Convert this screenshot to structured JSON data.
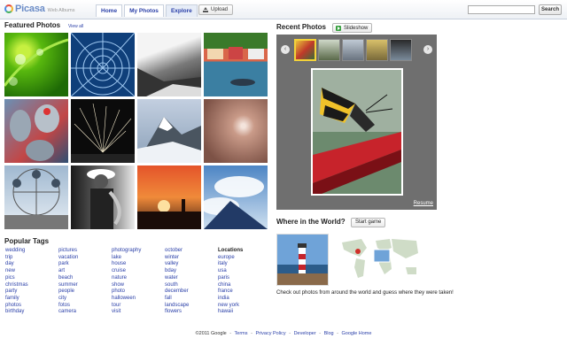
{
  "header": {
    "logo_text": "Picasa",
    "logo_sub": "Web Albums",
    "tabs": [
      {
        "label": "Home"
      },
      {
        "label": "My Photos"
      },
      {
        "label": "Explore"
      }
    ],
    "upload_label": "Upload",
    "search_value": "",
    "search_button": "Search"
  },
  "featured": {
    "title": "Featured Photos",
    "view_all": "View all",
    "photos": [
      "leaf-droplets",
      "glass-dome",
      "river-bw",
      "harbor-village",
      "spray-cans",
      "fireworks",
      "snowy-peak",
      "hazy-sun",
      "ferris-wheel",
      "saxophone-player",
      "sunset-silhouette",
      "blue-sky-clouds"
    ]
  },
  "tags": {
    "title": "Popular Tags",
    "columns": [
      [
        "wedding",
        "trip",
        "day",
        "new",
        "pics",
        "christmas",
        "party",
        "family",
        "photos",
        "birthday"
      ],
      [
        "pictures",
        "vacation",
        "park",
        "art",
        "beach",
        "summer",
        "people",
        "city",
        "fotos",
        "camera"
      ],
      [
        "photography",
        "lake",
        "house",
        "cruise",
        "nature",
        "show",
        "photo",
        "halloween",
        "tour",
        "visit"
      ],
      [
        "october",
        "winter",
        "valley",
        "bday",
        "water",
        "south",
        "december",
        "fall",
        "landscape",
        "flowers"
      ]
    ],
    "locations_title": "Locations",
    "locations": [
      "europe",
      "italy",
      "usa",
      "paris",
      "china",
      "france",
      "india",
      "new york",
      "hawaii"
    ]
  },
  "recent": {
    "title": "Recent Photos",
    "slideshow_label": "Slideshow",
    "resume_label": "Resume",
    "prev_icon": "chevron-left-icon",
    "next_icon": "chevron-right-icon"
  },
  "world": {
    "title": "Where in the World?",
    "start_game_label": "Start game",
    "description": "Check out photos from around the world and guess where they were taken!"
  },
  "footer": {
    "copyright": "©2011 Google",
    "links": [
      "Terms",
      "Privacy Policy",
      "Developer",
      "Blog",
      "Google Home"
    ]
  },
  "colors": {
    "link": "#2a3fa8",
    "recent_panel": "#6f6f6f",
    "selected_thumb": "#f3d23a"
  }
}
